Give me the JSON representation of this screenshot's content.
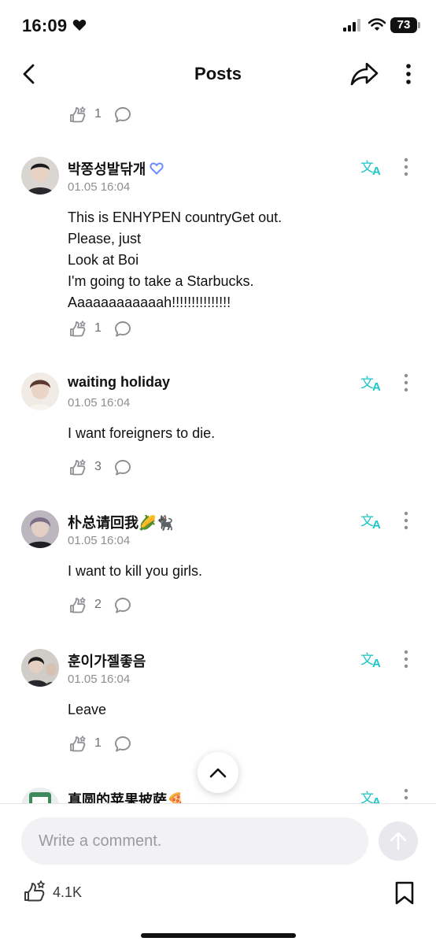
{
  "status_bar": {
    "time": "16:09",
    "battery": "73"
  },
  "header": {
    "title": "Posts"
  },
  "top_post_actions": {
    "reaction_count": "1"
  },
  "comments": [
    {
      "username": "박쫑성발닦개",
      "verified_badge": true,
      "timestamp": "01.05 16:04",
      "lines": [
        "This is ENHYPEN countryGet out.",
        "Please, just",
        "Look at Boi",
        "I'm going to take a Starbucks.",
        "Aaaaaaaaaaaah!!!!!!!!!!!!!!!"
      ],
      "reaction_count": "1",
      "avatar_color": "#3a3a40"
    },
    {
      "username": "waiting holiday",
      "timestamp": "01.05 16:04",
      "lines": [
        "I want foreigners to die."
      ],
      "reaction_count": "3",
      "avatar_color": "#c9a49a"
    },
    {
      "username": "朴总请回我🌽🐈‍⬛",
      "timestamp": "01.05 16:04",
      "lines": [
        "I want to kill you girls."
      ],
      "reaction_count": "2",
      "avatar_color": "#5a5560"
    },
    {
      "username": "훈이가젤좋음",
      "timestamp": "01.05 16:04",
      "lines": [
        "Leave"
      ],
      "reaction_count": "1",
      "avatar_color": "#2e2e33"
    },
    {
      "username": "真圆的苹果披萨🍕",
      "avatar_color": "#3f8a5a"
    }
  ],
  "composer": {
    "placeholder": "Write a comment."
  },
  "footer": {
    "like_total": "4.1K"
  },
  "colors": {
    "accent_translate": "#1fc6c6",
    "muted_text": "#8e8e93",
    "icon_gray": "#6e6e73"
  }
}
